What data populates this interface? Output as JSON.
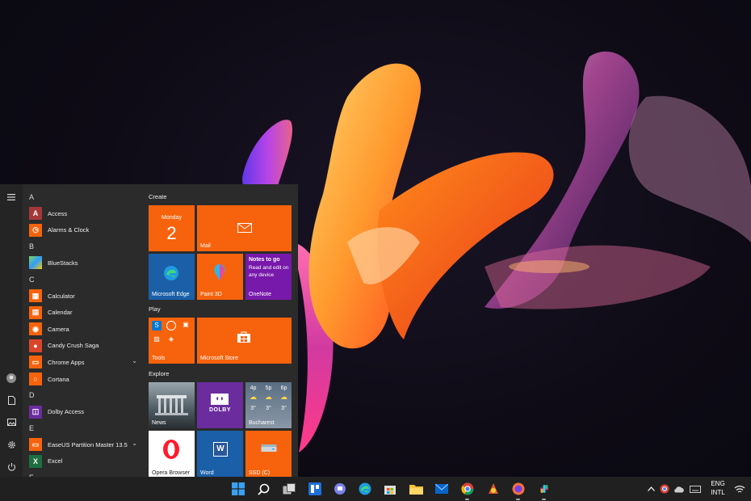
{
  "start_menu": {
    "letters": {
      "a": "A",
      "b": "B",
      "c": "C",
      "d": "D",
      "e": "E",
      "f": "F"
    },
    "apps": {
      "access": "Access",
      "alarms": "Alarms & Clock",
      "bluestacks": "BlueStacks",
      "calculator": "Calculator",
      "calendar": "Calendar",
      "camera": "Camera",
      "candy": "Candy Crush Saga",
      "chrome_apps": "Chrome Apps",
      "cortana": "Cortana",
      "dolby": "Dolby Access",
      "easeus": "EaseUS Partition Master 13.5",
      "excel": "Excel"
    },
    "groups": {
      "create": "Create",
      "play": "Play",
      "explore": "Explore"
    },
    "tiles": {
      "calendar_day": "Monday",
      "calendar_date": "2",
      "mail": "Mail",
      "edge": "Microsoft Edge",
      "paint3d": "Paint 3D",
      "onenote": "OneNote",
      "onenote_title": "Notes to go",
      "onenote_body": "Read and edit on any device",
      "tools": "Tools",
      "store": "Microsoft Store",
      "news": "News",
      "dolby_logo": "DOLBY",
      "weather_city": "Bucharest",
      "weather_hours": [
        "4p",
        "5p",
        "6p"
      ],
      "weather_temps": [
        "3°",
        "3°",
        "3°"
      ],
      "opera": "Opera Browser",
      "word": "Word",
      "ssd": "SSD (C)"
    }
  },
  "taskbar": {
    "lang_top": "ENG",
    "lang_bottom": "INTL"
  },
  "colors": {
    "accent_orange": "#f7630c",
    "menu_bg": "#2b2b2b",
    "taskbar_bg": "#202020"
  }
}
